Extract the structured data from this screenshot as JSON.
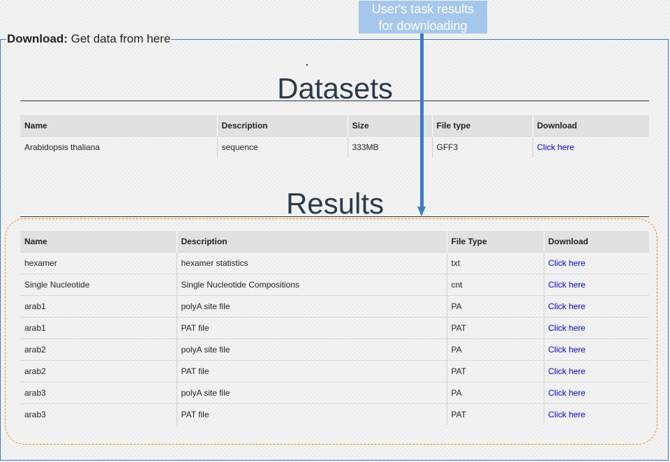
{
  "download": {
    "label": "Download:",
    "text": " Get data from here"
  },
  "callout": {
    "line1": "User's task results",
    "line2": "for downloading"
  },
  "datasets": {
    "title": "Datasets",
    "headers": [
      "Name",
      "Description",
      "Size",
      "File type",
      "Download"
    ],
    "rows": [
      [
        "Arabidopsis thaliana",
        "sequence",
        "333MB",
        "GFF3",
        "Click here"
      ]
    ]
  },
  "results": {
    "title": "Results",
    "headers": [
      "Name",
      "Description",
      "File Type",
      "Download"
    ],
    "rows": [
      [
        "hexamer",
        "hexamer statistics",
        "txt",
        "Click here"
      ],
      [
        "Single Nucleotide",
        "Single Nucleotide Compositions",
        "cnt",
        "Click here"
      ],
      [
        "arab1",
        "polyA site file",
        "PA",
        "Click here"
      ],
      [
        "arab1",
        "PAT file",
        "PAT",
        "Click here"
      ],
      [
        "arab2",
        "polyA site file",
        "PA",
        "Click here"
      ],
      [
        "arab2",
        "PAT file",
        "PAT",
        "Click here"
      ],
      [
        "arab3",
        "polyA site file",
        "PA",
        "Click here"
      ],
      [
        "arab3",
        "PAT file",
        "PAT",
        "Click here"
      ]
    ]
  }
}
